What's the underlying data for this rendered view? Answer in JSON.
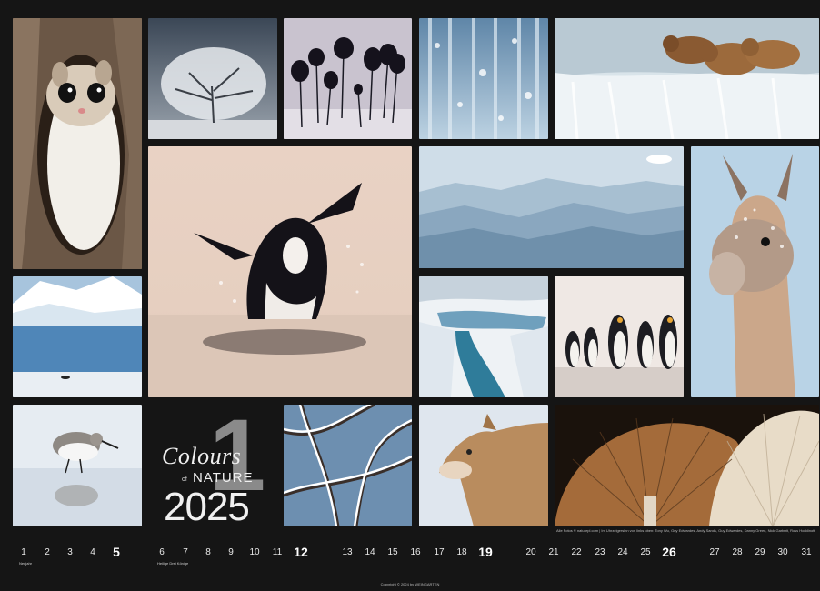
{
  "title": {
    "number": "1",
    "colours": "Colours",
    "of": "of",
    "nature": "NATURE",
    "year": "2025"
  },
  "credits": "Alle Fotos © naturepl.com | Im Uhrzeigersinn von links oben: Tony Wu, Guy Edwardes, Andy Sands, Guy Edwardes, Danny Green, Nick Garbutt, Ross Hoddinott, Nick Garbutt, Chris Gomersall, Andy Sands, Tom Whitfield, Espen Bergersen, Charlie Hamilton James, Roy Mangersnes, Nick Garbutt",
  "copyright": "Copyright © 2024 by WEINGARTEN",
  "calendar": {
    "days": [
      "1",
      "2",
      "3",
      "4",
      "5",
      "6",
      "7",
      "8",
      "9",
      "10",
      "11",
      "12",
      "13",
      "14",
      "15",
      "16",
      "17",
      "18",
      "19",
      "20",
      "21",
      "22",
      "23",
      "24",
      "25",
      "26",
      "27",
      "28",
      "29",
      "30",
      "31"
    ],
    "sundays": [
      "5",
      "12",
      "19",
      "26"
    ],
    "notes": [
      {
        "day": "1",
        "label": "Neujahr"
      },
      {
        "day": "6",
        "label": "Heilige Drei Könige"
      }
    ]
  },
  "photos": [
    "flying-squirrel",
    "frosted-tree",
    "slime-mould",
    "frozen-forest",
    "bears-waterfall",
    "orca",
    "misty-mountains",
    "llama",
    "snowy-bay",
    "icy-canyon",
    "penguins",
    "sandpiper",
    "snowy-branches",
    "puma",
    "mushroom-gills"
  ]
}
